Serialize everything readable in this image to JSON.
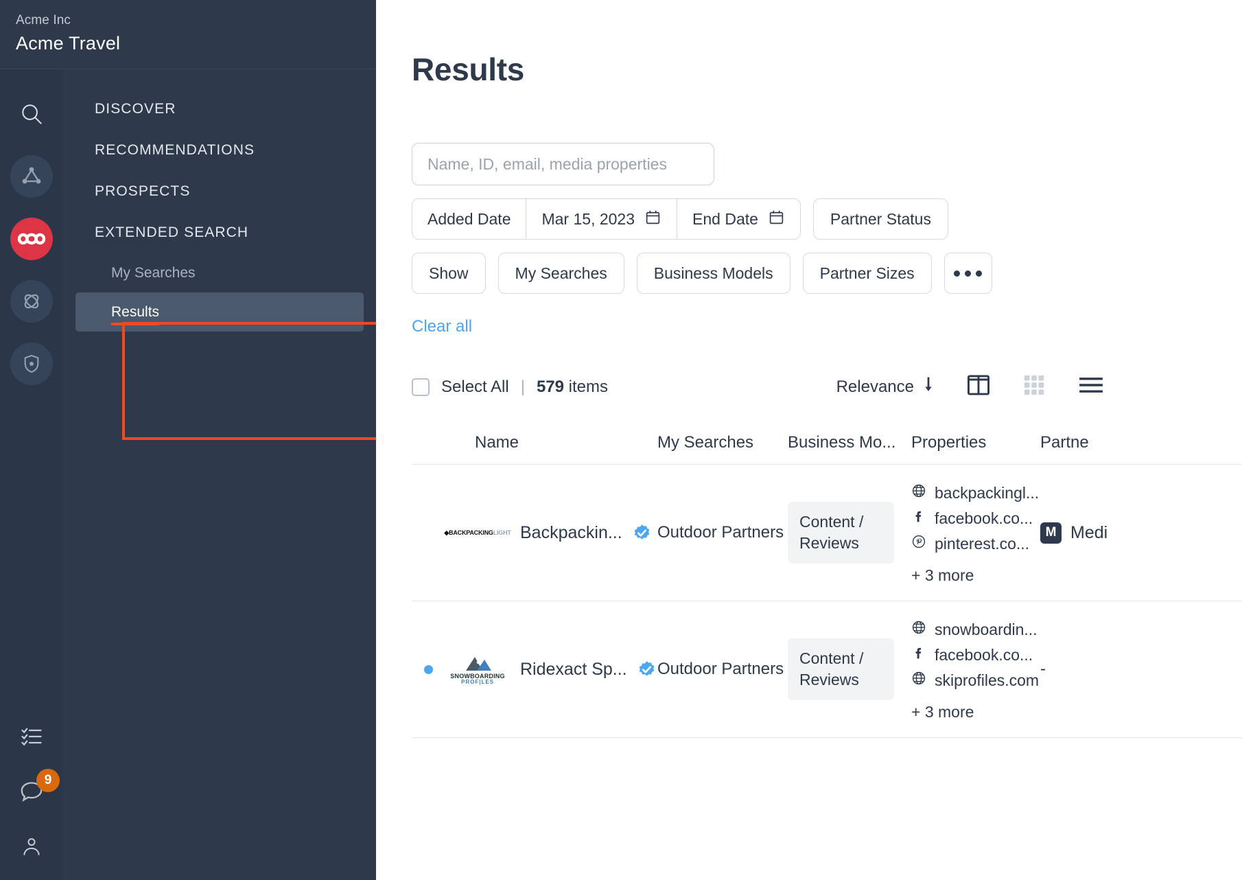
{
  "sidebar": {
    "brand": {
      "org": "Acme Inc",
      "name": "Acme Travel"
    },
    "rail": [
      {
        "icon": "search-icon",
        "state": "plain"
      },
      {
        "icon": "network-nodes-icon",
        "state": "dim"
      },
      {
        "icon": "infinity-icon",
        "state": "active"
      },
      {
        "icon": "atom-icon",
        "state": "dim"
      },
      {
        "icon": "shield-icon",
        "state": "dim"
      }
    ],
    "rail_bottom": [
      {
        "icon": "checklist-icon"
      },
      {
        "icon": "chat-bubble-icon",
        "badge": "9"
      },
      {
        "icon": "user-icon"
      }
    ],
    "nav": [
      {
        "label": "DISCOVER",
        "type": "section"
      },
      {
        "label": "RECOMMENDATIONS",
        "type": "section"
      },
      {
        "label": "PROSPECTS",
        "type": "section"
      },
      {
        "label": "EXTENDED SEARCH",
        "type": "section"
      },
      {
        "label": "My Searches",
        "type": "sub"
      },
      {
        "label": "Results",
        "type": "sub",
        "selected": true
      }
    ]
  },
  "main": {
    "title": "Results",
    "search": {
      "value": "",
      "placeholder": "Name, ID, email, media properties"
    },
    "filters": {
      "added_date_label": "Added Date",
      "added_date_value": "Mar 15, 2023",
      "end_date_label": "End Date",
      "partner_status": "Partner Status",
      "show": "Show",
      "my_searches": "My Searches",
      "business_models": "Business Models",
      "partner_sizes": "Partner Sizes",
      "more": "•••",
      "clear_all": "Clear all"
    },
    "toolbar": {
      "select_all": "Select All",
      "separator": "|",
      "count": "579",
      "count_unit": "items",
      "sort_label": "Relevance",
      "view_split": "split-view-icon",
      "view_grid": "grid-view-icon",
      "view_list": "list-view-icon"
    },
    "table": {
      "headers": {
        "name": "Name",
        "my_searches": "My Searches",
        "business_model": "Business Mo...",
        "properties": "Properties",
        "partner": "Partne"
      },
      "rows": [
        {
          "selected_dot": false,
          "logo_primary": "BACKPACKING",
          "logo_secondary": "LIGHT",
          "name": "Backpackin...",
          "verified": true,
          "my_searches": "Outdoor Partners",
          "business_model": "Content / Reviews",
          "properties": [
            {
              "icon": "globe-icon",
              "label": "backpackingl..."
            },
            {
              "icon": "facebook-icon",
              "label": "facebook.co..."
            },
            {
              "icon": "pinterest-icon",
              "label": "pinterest.co..."
            }
          ],
          "properties_more": "+ 3 more",
          "partner_badge": "M",
          "partner_label": "Medi"
        },
        {
          "selected_dot": true,
          "logo_primary": "SNOWBOARDING",
          "logo_secondary": "PROF|LES",
          "name": "Ridexact Sp...",
          "verified": true,
          "my_searches": "Outdoor Partners",
          "business_model": "Content / Reviews",
          "properties": [
            {
              "icon": "globe-icon",
              "label": "snowboardin..."
            },
            {
              "icon": "facebook-icon",
              "label": "facebook.co..."
            },
            {
              "icon": "globe-icon",
              "label": "skiprofiles.com"
            }
          ],
          "properties_more": "+ 3 more",
          "partner_badge": "",
          "partner_label": "-"
        }
      ]
    }
  },
  "colors": {
    "sidebar_bg": "#2e3a4c",
    "rail_bg": "#2b3648",
    "accent_red": "#dc3545",
    "highlight_red": "#f04a24",
    "link_blue": "#4aa7f0",
    "badge_orange": "#d9690d",
    "text_dark": "#2e3a4c"
  }
}
